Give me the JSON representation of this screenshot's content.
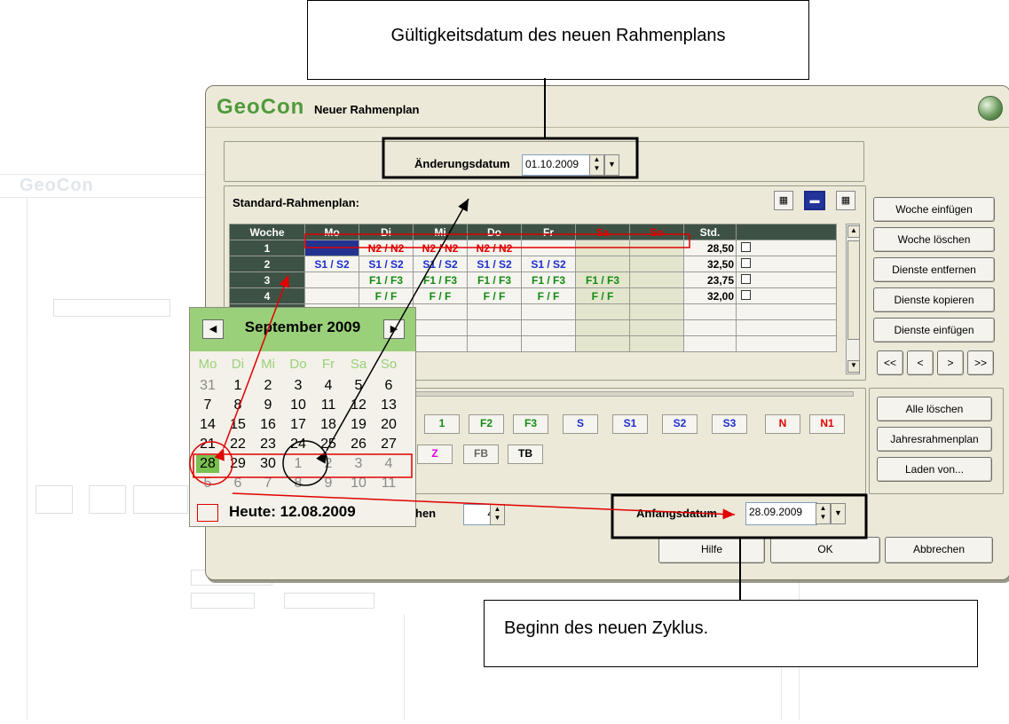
{
  "callouts": {
    "top": "Gültigkeitsdatum des neuen Rahmenplans",
    "bottom": "Beginn des neuen Zyklus."
  },
  "window": {
    "logo": "GeoCon",
    "title": "Neuer Rahmenplan",
    "aenderungsdatum_label": "Änderungsdatum",
    "aenderungsdatum_value": "01.10.2009",
    "standard_label": "Standard-Rahmenplan:",
    "anfangsdatum_label": "Anfangsdatum",
    "anfangsdatum_value": "28.09.2009",
    "weeks_label_fragment": "hen",
    "weeks_value": "4"
  },
  "table": {
    "headers": [
      "Woche",
      "Mo",
      "Di",
      "Mi",
      "Do",
      "Fr",
      "Sa",
      "So",
      "Std."
    ],
    "rows": [
      {
        "week": "1",
        "cells": [
          "",
          "N2 / N2",
          "N2 / N2",
          "N2 / N2",
          "",
          "",
          ""
        ],
        "std": "28,50"
      },
      {
        "week": "2",
        "cells": [
          "S1 / S2",
          "S1 / S2",
          "S1 / S2",
          "S1 / S2",
          "S1 / S2",
          "",
          ""
        ],
        "std": "32,50"
      },
      {
        "week": "3",
        "cells": [
          "",
          "F1 / F3",
          "F1 / F3",
          "F1 / F3",
          "F1 / F3",
          "F1 / F3",
          ""
        ],
        "std": "23,75"
      },
      {
        "week": "4",
        "cells": [
          "",
          "F / F",
          "F / F",
          "F / F",
          "F / F",
          "F / F",
          ""
        ],
        "std": "32,00"
      }
    ]
  },
  "side_buttons": [
    "Woche einfügen",
    "Woche löschen",
    "Dienste entfernen",
    "Dienste kopieren",
    "Dienste einfügen"
  ],
  "nav_buttons": [
    "<<",
    "<",
    ">",
    ">>"
  ],
  "side_buttons2": [
    "Alle löschen",
    "Jahresrahmenplan",
    "Laden von..."
  ],
  "bottom_buttons": [
    "Hilfe",
    "OK",
    "Abbrechen"
  ],
  "chips_row1": [
    "1",
    "F2",
    "F3",
    "S",
    "S1",
    "S2",
    "S3",
    "N",
    "N1"
  ],
  "chips_row2": [
    "Z",
    "FB",
    "TB"
  ],
  "colors": {
    "red": "#e00000",
    "blue": "#1c2ed0",
    "green": "#138a13",
    "magenta": "#e000e0",
    "calendar_header": "#9ad07a",
    "selected_day": "#78c050"
  },
  "calendar": {
    "month": "September 2009",
    "weekdays": [
      "Mo",
      "Di",
      "Mi",
      "Do",
      "Fr",
      "Sa",
      "So"
    ],
    "weeks": [
      [
        "31",
        "1",
        "2",
        "3",
        "4",
        "5",
        "6"
      ],
      [
        "7",
        "8",
        "9",
        "10",
        "11",
        "12",
        "13"
      ],
      [
        "14",
        "15",
        "16",
        "17",
        "18",
        "19",
        "20"
      ],
      [
        "21",
        "22",
        "23",
        "24",
        "25",
        "26",
        "27"
      ],
      [
        "28",
        "29",
        "30",
        "1",
        "2",
        "3",
        "4"
      ],
      [
        "5",
        "6",
        "7",
        "8",
        "9",
        "10",
        "11"
      ]
    ],
    "today": "Heute: 12.08.2009",
    "prev": "◀",
    "next": "▶"
  }
}
